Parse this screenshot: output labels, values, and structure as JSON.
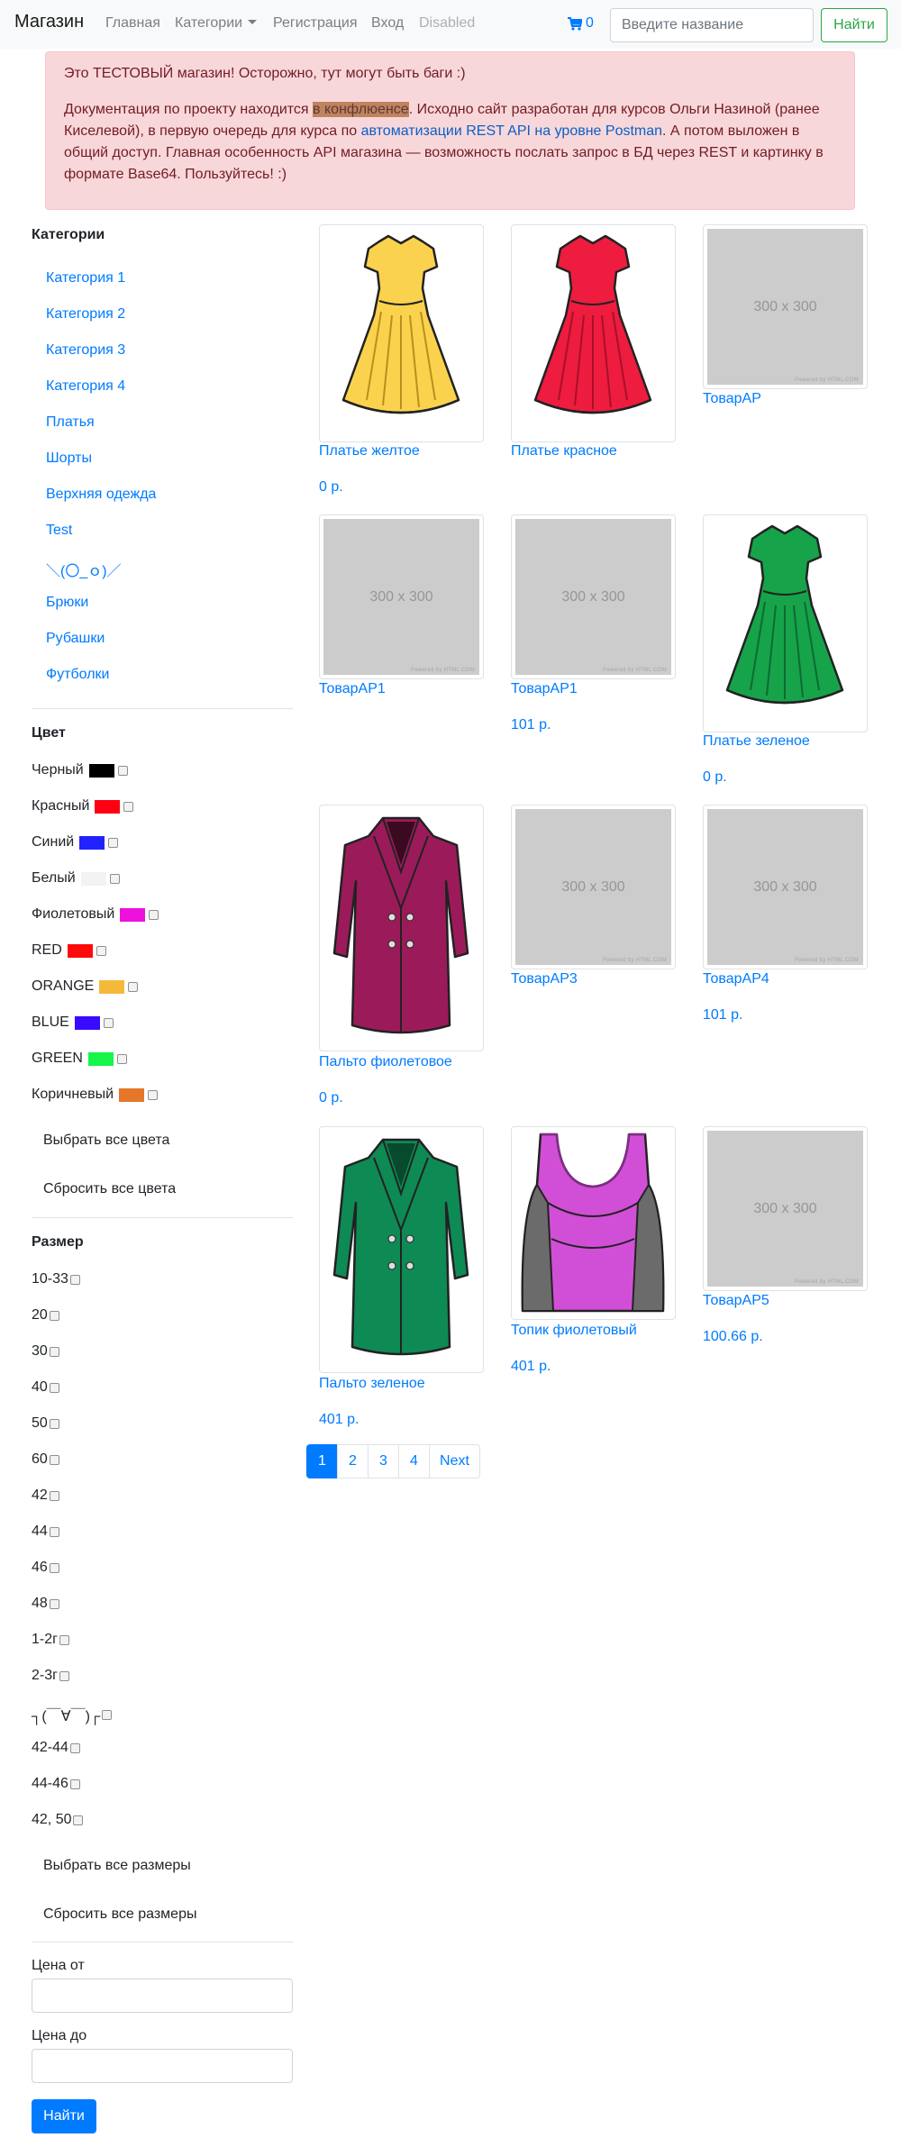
{
  "navbar": {
    "brand": "Магазин",
    "links": [
      "Главная",
      "Категории",
      "Регистрация",
      "Вход",
      "Disabled"
    ],
    "cart_count": "0",
    "search_placeholder": "Введите название",
    "search_button": "Найти"
  },
  "alert": {
    "line1": "Это ТЕСТОВЫЙ магазин! Осторожно, тут могут быть баги :)",
    "p2_a": "Документация по проекту находится ",
    "p2_link1": "в конфлюенсе",
    "p2_b": ".  Исходно сайт разработан для курсов Ольги Назиной (ранее Киселевой), в первую очередь для курса по ",
    "p2_link2": "автоматизации REST API на уровне Postman",
    "p2_c": ". А потом выложен в общий доступ. Главная особенность API магазина — возможность послать запрос в БД через REST и картинку в формате Base64.  Пользуйтесь! :)"
  },
  "sidebar": {
    "categories_title": "Категории",
    "categories": [
      "Категория 1",
      "Категория 2",
      "Категория 3",
      "Категория 4",
      "Платья",
      "Шорты",
      "Верхняя одежда",
      "Test",
      "＼(〇_ｏ)／",
      "Брюки",
      "Рубашки",
      "Футболки"
    ],
    "color_title": "Цвет",
    "colors": [
      {
        "name": "Черный",
        "hex": "#000000"
      },
      {
        "name": "Красный",
        "hex": "#ff0012"
      },
      {
        "name": "Синий",
        "hex": "#2222ff"
      },
      {
        "name": "Белый",
        "hex": "#f3f3f3"
      },
      {
        "name": "Фиолетовый",
        "hex": "#ee11dd"
      },
      {
        "name": "RED",
        "hex": "#ff0a0a"
      },
      {
        "name": "ORANGE",
        "hex": "#f5b93a"
      },
      {
        "name": "BLUE",
        "hex": "#3a0aff"
      },
      {
        "name": "GREEN",
        "hex": "#16f54a"
      },
      {
        "name": "Коричневый",
        "hex": "#e5762a"
      }
    ],
    "select_all_colors": "Выбрать все цвета",
    "reset_all_colors": "Сбросить все цвета",
    "size_title": "Размер",
    "sizes": [
      "10-33",
      "20",
      "30",
      "40",
      "50",
      "60",
      "42",
      "44",
      "46",
      "48",
      "1-2г",
      "2-3г",
      "┐(￣∀￣)┌",
      "42-44",
      "44-46",
      "42, 50"
    ],
    "select_all_sizes": "Выбрать все размеры",
    "reset_all_sizes": "Сбросить все размеры",
    "price_from_label": "Цена от",
    "price_to_label": "Цена до",
    "find_button": "Найти"
  },
  "products": [
    {
      "name": "Платье желтое",
      "price": "0 р.",
      "image": "yellow-dress"
    },
    {
      "name": "Платье красное",
      "price": "",
      "image": "red-dress"
    },
    {
      "name": "ТоварАР",
      "price": "",
      "image": "placeholder"
    },
    {
      "name": "ТоварАР1",
      "price": "",
      "image": "placeholder"
    },
    {
      "name": "ТоварАР1",
      "price": "101 р.",
      "image": "placeholder"
    },
    {
      "name": "Платье зеленое",
      "price": "0 р.",
      "image": "green-dress"
    },
    {
      "name": "Пальто фиолетовое",
      "price": "0 р.",
      "image": "purple-coat"
    },
    {
      "name": "ТоварАР3",
      "price": "",
      "image": "placeholder"
    },
    {
      "name": "ТоварАР4",
      "price": "101 р.",
      "image": "placeholder"
    },
    {
      "name": "Пальто зеленое",
      "price": "401 р.",
      "image": "green-coat"
    },
    {
      "name": "Топик фиолетовый",
      "price": "401 р.",
      "image": "purple-top"
    },
    {
      "name": "ТоварАР5",
      "price": "100.66 р.",
      "image": "placeholder"
    }
  ],
  "placeholder_text": "300 x 300",
  "placeholder_credit": "Powered by HTML.COM",
  "pagination": [
    "1",
    "2",
    "3",
    "4",
    "Next"
  ]
}
